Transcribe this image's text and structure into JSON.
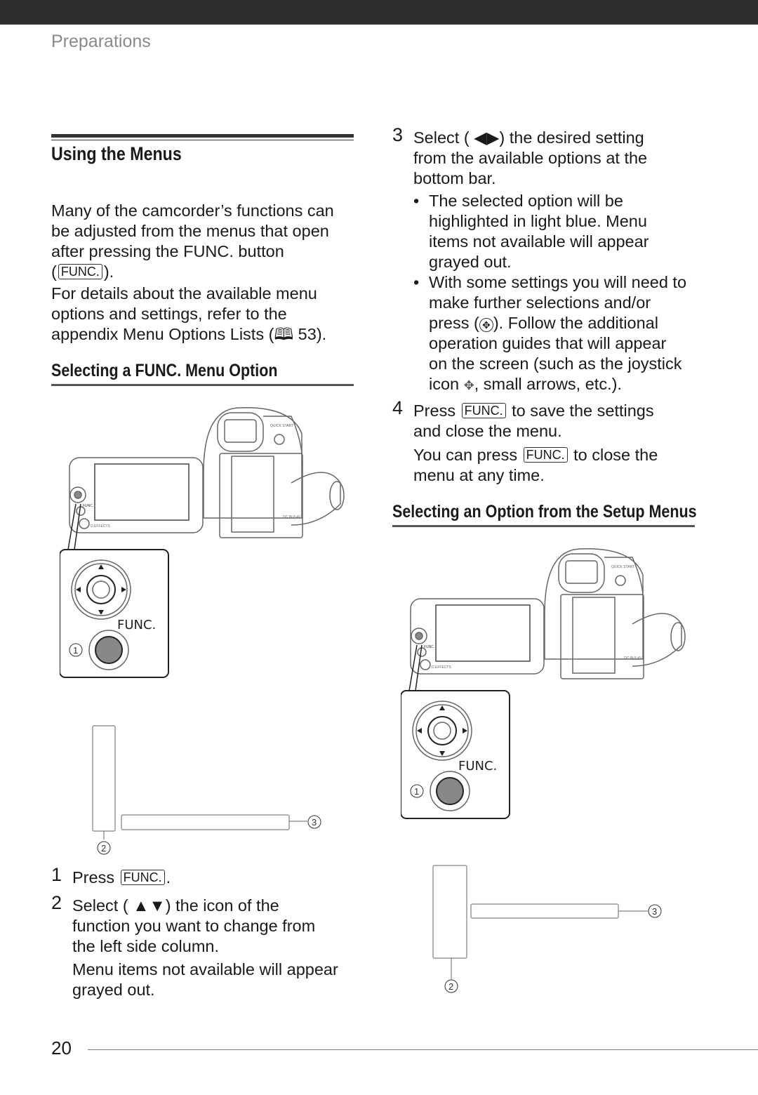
{
  "header": {
    "section": "Preparations"
  },
  "left": {
    "title": "Using the Menus",
    "intro": {
      "l1": "Many of the camcorder’s functions can",
      "l2": "be adjusted from the menus that open",
      "l3": "after pressing the FUNC. button",
      "l4a": "(",
      "l4key": "FUNC.",
      "l4b": ").",
      "l5": "For details about the available menu",
      "l6": "options and settings, refer to the",
      "l7a": "appendix Menu Options Lists (",
      "l7b": " 53)."
    },
    "subheading": "Selecting a FUNC. Menu Option",
    "steps": [
      {
        "num": "1",
        "a": "Press ",
        "key": "FUNC.",
        "b": "."
      },
      {
        "num": "2",
        "l1a": "Select ( ",
        "l1b": ") the icon of the",
        "l2": "function you want  to change from",
        "l3": "the left side column.",
        "note1": "Menu items not available will appear",
        "note2": "grayed out."
      }
    ]
  },
  "right": {
    "step3": {
      "num": "3",
      "l1a": "Select ( ",
      "l1b": ") the desired setting",
      "l2": "from the available options at the",
      "l3": "bottom bar.",
      "b1": [
        "The selected option will be",
        "highlighted in light blue. Menu",
        "items not available will appear",
        "grayed out."
      ],
      "b2": {
        "l1": "With some settings you will need to",
        "l2": "make further selections and/or",
        "l3a": "press (",
        "l3b": "). Follow the additional",
        "l4": "operation guides that will appear",
        "l5": "on the screen (such as the joystick",
        "l6a": "icon ",
        "l6b": ", small arrows, etc.)."
      }
    },
    "step4": {
      "num": "4",
      "l1a": "Press ",
      "key": "FUNC.",
      "l1b": " to save the settings",
      "l2": "and close the menu.",
      "n1a": "You can press ",
      "nkey": "FUNC.",
      "n1b": " to close the",
      "n2": "menu at any time."
    },
    "subheading": "Selecting an Option from the Setup Menus"
  },
  "figure": {
    "func_label": "FUNC.",
    "small_func": "FUNC.",
    "deffects": "D.EFFECTS",
    "quick_start": "QUICK START",
    "dc_in": "DC IN 8.4V",
    "callouts": [
      "1",
      "2",
      "3"
    ]
  },
  "footer": {
    "page_number": "20"
  }
}
